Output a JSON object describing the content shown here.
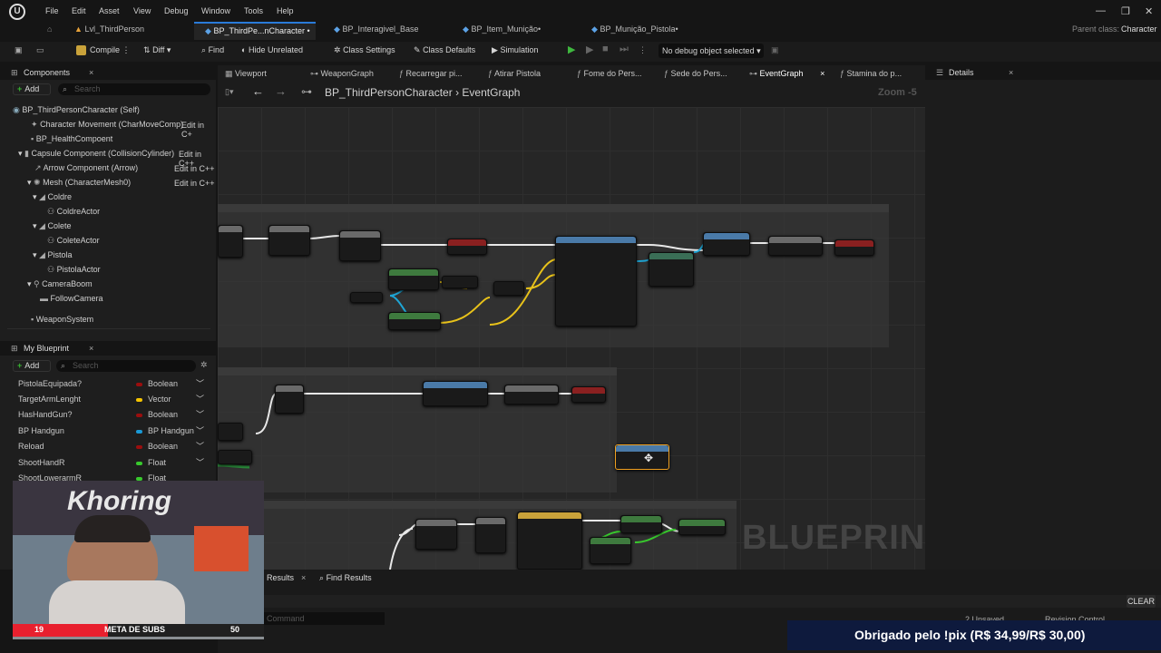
{
  "menubar": {
    "items": [
      "File",
      "Edit",
      "Asset",
      "View",
      "Debug",
      "Window",
      "Tools",
      "Help"
    ]
  },
  "tabs": [
    {
      "label": "Lvl_ThirdPerson"
    },
    {
      "label": "BP_ThirdPe...nCharacter",
      "modified": "•",
      "close": "×"
    },
    {
      "label": "BP_Interagivel_Base"
    },
    {
      "label": "BP_Item_Munição•"
    },
    {
      "label": "BP_Munição_Pistola•"
    }
  ],
  "parent_class": {
    "label": "Parent class:",
    "value": "Character"
  },
  "toolbar": {
    "compile": "Compile",
    "diff": "Diff",
    "find": "Find",
    "hide_unrelated": "Hide Unrelated",
    "class_settings": "Class Settings",
    "class_defaults": "Class Defaults",
    "simulation": "Simulation",
    "debug_object": "No debug object selected"
  },
  "components": {
    "title": "Components",
    "add": "Add",
    "search_placeholder": "Search",
    "tree": [
      {
        "label": "BP_ThirdPersonCharacter (Self)"
      },
      {
        "label": "Character Movement (CharMoveComp)",
        "edit": "Edit in C+"
      },
      {
        "label": "BP_HealthCompoent"
      },
      {
        "label": "Capsule Component (CollisionCylinder)",
        "edit": "Edit in C++"
      },
      {
        "label": "Arrow Component (Arrow)",
        "edit": "Edit in C++"
      },
      {
        "label": "Mesh (CharacterMesh0)",
        "edit": "Edit in C++"
      },
      {
        "label": "Coldre"
      },
      {
        "label": "ColdreActor"
      },
      {
        "label": "Colete"
      },
      {
        "label": "ColeteActor"
      },
      {
        "label": "Pistola"
      },
      {
        "label": "PistolaActor"
      },
      {
        "label": "CameraBoom"
      },
      {
        "label": "FollowCamera"
      },
      {
        "label": "WeaponSystem"
      }
    ]
  },
  "my_blueprint": {
    "title": "My Blueprint",
    "add": "Add",
    "search_placeholder": "Search",
    "variables": [
      {
        "name": "PistolaEquipada?",
        "type": "Boolean",
        "color": "#9b0e0e"
      },
      {
        "name": "TargetArmLenght",
        "type": "Vector",
        "color": "#f5c400"
      },
      {
        "name": "HasHandGun?",
        "type": "Boolean",
        "color": "#9b0e0e"
      },
      {
        "name": "BP Handgun",
        "type": "BP Handgun",
        "color": "#1a9ad6"
      },
      {
        "name": "Reload",
        "type": "Boolean",
        "color": "#9b0e0e"
      },
      {
        "name": "ShootHandR",
        "type": "Float",
        "color": "#38c92d"
      },
      {
        "name": "ShootLowerarmR",
        "type": "Float",
        "color": "#38c92d"
      }
    ]
  },
  "graph_tabs": [
    {
      "label": "Viewport"
    },
    {
      "label": "WeaponGraph"
    },
    {
      "label": "Recarregar pi..."
    },
    {
      "label": "Atirar Pistola"
    },
    {
      "label": "Fome do Pers..."
    },
    {
      "label": "Sede do Pers..."
    },
    {
      "label": "EventGraph",
      "close": "×"
    },
    {
      "label": "Stamina do p..."
    }
  ],
  "breadcrumb": {
    "root": "BP_ThirdPersonCharacter",
    "sep": "›",
    "leaf": "EventGraph"
  },
  "zoom": "Zoom -5",
  "watermark": "BLUEPRINT",
  "details": {
    "title": "Details",
    "close": "×"
  },
  "bottom": {
    "results_tab": "Results",
    "find_results": "Find Results",
    "clear": "CLEAR",
    "command_placeholder": "Command",
    "unsaved": "2 Unsaved",
    "revision": "Revision Control"
  },
  "overlay": {
    "webcam_logo": "Khoring",
    "subs_current": "19",
    "subs_label": "META DE SUBS",
    "subs_goal": "50",
    "subs_progress": 0.38,
    "pix": "Obrigado pelo !pix (R$ 34,99/R$ 30,00)"
  }
}
